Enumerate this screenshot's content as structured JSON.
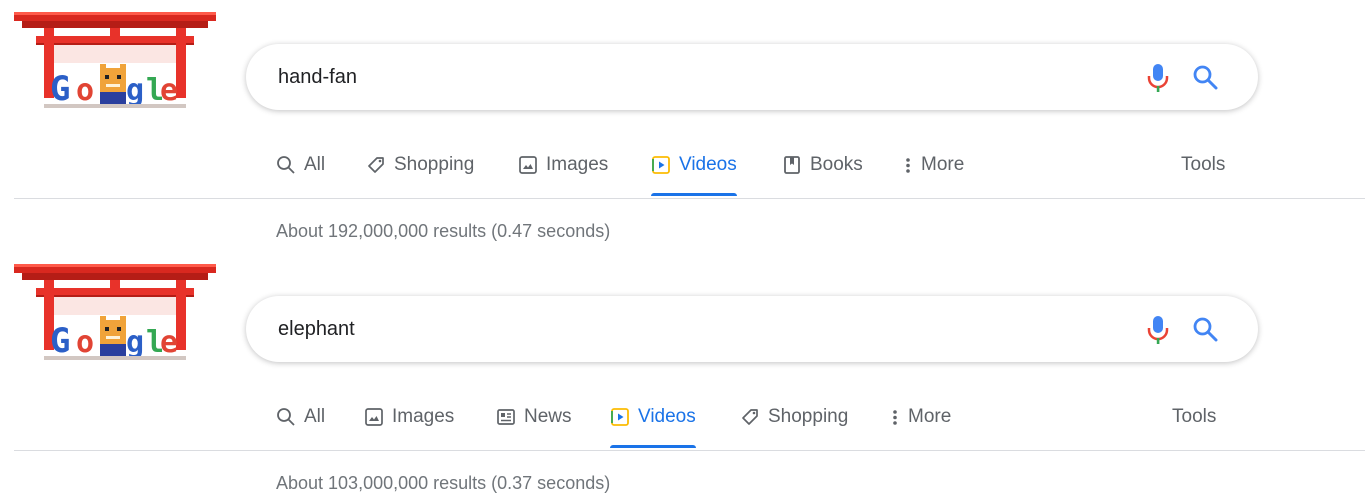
{
  "panels": [
    {
      "search": {
        "query": "hand-fan"
      },
      "tabs": [
        {
          "label": "All",
          "icon": "search-icon",
          "active": false
        },
        {
          "label": "Shopping",
          "icon": "tag-icon",
          "active": false
        },
        {
          "label": "Images",
          "icon": "image-icon",
          "active": false
        },
        {
          "label": "Videos",
          "icon": "video-icon",
          "active": true
        },
        {
          "label": "Books",
          "icon": "book-icon",
          "active": false
        },
        {
          "label": "More",
          "icon": "more-vert-icon",
          "active": false
        }
      ],
      "tools_label": "Tools",
      "result_stats": "About 192,000,000 results (0.47 seconds)"
    },
    {
      "search": {
        "query": "elephant"
      },
      "tabs": [
        {
          "label": "All",
          "icon": "search-icon",
          "active": false
        },
        {
          "label": "Images",
          "icon": "image-icon",
          "active": false
        },
        {
          "label": "News",
          "icon": "news-icon",
          "active": false
        },
        {
          "label": "Videos",
          "icon": "video-icon",
          "active": true
        },
        {
          "label": "Shopping",
          "icon": "tag-icon",
          "active": false
        },
        {
          "label": "More",
          "icon": "more-vert-icon",
          "active": false
        }
      ],
      "tools_label": "Tools",
      "result_stats": "About 103,000,000 results (0.37 seconds)"
    }
  ],
  "colors": {
    "accent_blue": "#1a73e8",
    "tab_gray": "#5f6368",
    "stats_gray": "#70757a",
    "torii_red": "#e8322a"
  }
}
